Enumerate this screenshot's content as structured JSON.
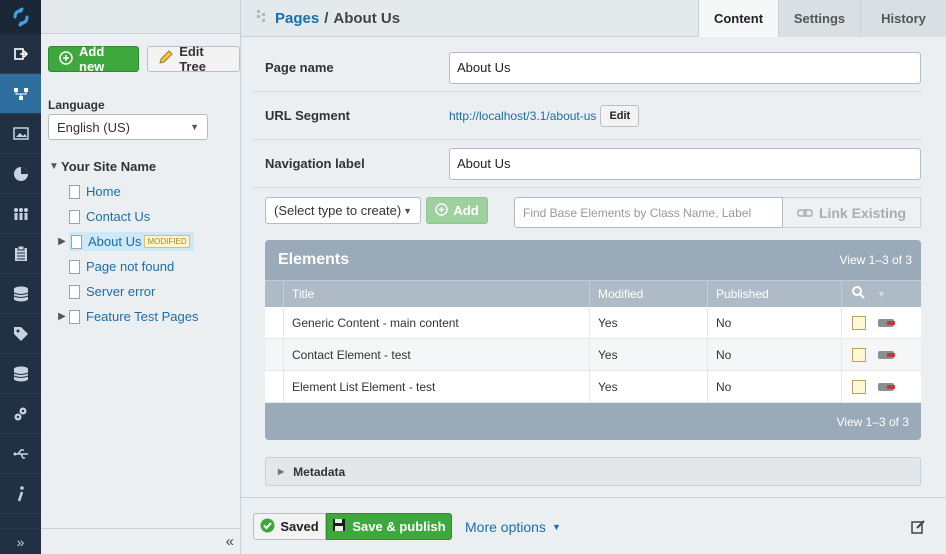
{
  "rail": {
    "items": [
      "logo-icon",
      "sign-out-icon",
      "sitetree-icon",
      "images-icon",
      "reports-icon",
      "security-icon",
      "clipboard-icon",
      "database-icon",
      "tag-icon",
      "database-2-icon",
      "gears-icon",
      "usb-icon",
      "info-icon"
    ],
    "expand_label": "»"
  },
  "tree": {
    "add_new": "Add new",
    "edit_tree": "Edit Tree",
    "language_label": "Language",
    "language_value": "English (US)",
    "root": "Your Site Name",
    "nodes": [
      {
        "label": "Home"
      },
      {
        "label": "Contact Us"
      },
      {
        "label": "About Us",
        "badge": "MODIFIED"
      },
      {
        "label": "Page not found"
      },
      {
        "label": "Server error"
      },
      {
        "label": "Feature Test Pages"
      }
    ],
    "collapse_label": "«"
  },
  "header": {
    "breadcrumb_parent": "Pages",
    "breadcrumb_sep": "/",
    "breadcrumb_current": "About Us",
    "tabs": [
      {
        "label": "Content"
      },
      {
        "label": "Settings"
      },
      {
        "label": "History"
      }
    ]
  },
  "form": {
    "page_name_label": "Page name",
    "page_name_value": "About Us",
    "url_label": "URL Segment",
    "url_value": "http://localhost/3.1/about-us",
    "url_edit": "Edit",
    "nav_label": "Navigation label",
    "nav_value": "About Us"
  },
  "elements": {
    "type_select": "(Select type to create)",
    "add": "Add",
    "find_placeholder": "Find Base Elements by Class Name, Label",
    "link_existing": "Link Existing",
    "title": "Elements",
    "count": "View 1–3 of 3",
    "columns": [
      "Title",
      "Modified",
      "Published"
    ],
    "rows": [
      {
        "title": "Generic Content - main content",
        "modified": "Yes",
        "published": "No"
      },
      {
        "title": "Contact Element - test",
        "modified": "Yes",
        "published": "No"
      },
      {
        "title": "Element List Element - test",
        "modified": "Yes",
        "published": "No"
      }
    ],
    "footer_count": "View 1–3 of 3"
  },
  "metadata": {
    "label": "Metadata"
  },
  "actions": {
    "saved": "Saved",
    "save_publish": "Save & publish",
    "more_options": "More options"
  },
  "colors": {
    "accent": "#1b6ea9",
    "green": "#3ea83e",
    "rail": "#223044"
  }
}
